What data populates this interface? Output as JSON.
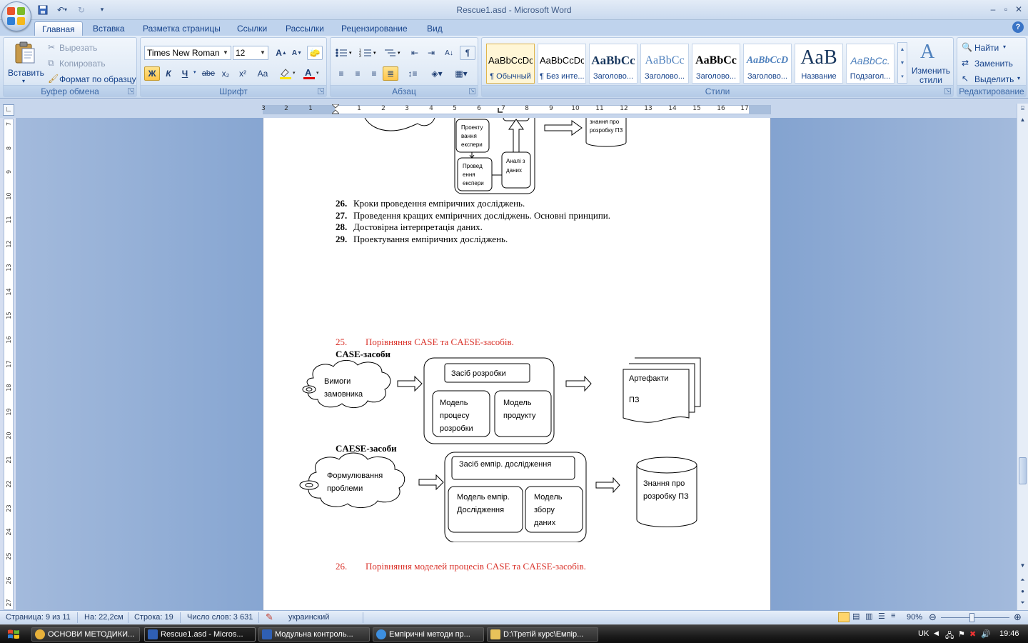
{
  "window": {
    "title": "Rescue1.asd - Microsoft Word",
    "controls": {
      "minimize": "–",
      "maximize": "▫",
      "close": "✕"
    }
  },
  "ribbon_tabs": [
    "Главная",
    "Вставка",
    "Разметка страницы",
    "Ссылки",
    "Рассылки",
    "Рецензирование",
    "Вид"
  ],
  "clipboard": {
    "paste": "Вставить",
    "cut": "Вырезать",
    "copy": "Копировать",
    "format_painter": "Формат по образцу",
    "title": "Буфер обмена"
  },
  "font": {
    "name": "Times New Roman",
    "size": "12",
    "bold": "Ж",
    "italic": "К",
    "underline": "Ч",
    "strike": "abe",
    "subscript": "x₂",
    "superscript": "x²",
    "case": "Aa",
    "title": "Шрифт"
  },
  "paragraph": {
    "title": "Абзац"
  },
  "styles": {
    "title": "Стили",
    "items": [
      {
        "sample": "AaBbCcDc",
        "name": "¶ Обычный"
      },
      {
        "sample": "AaBbCcDc",
        "name": "¶ Без инте..."
      },
      {
        "sample": "AaBbCc",
        "name": "Заголово..."
      },
      {
        "sample": "AaBbCc",
        "name": "Заголово..."
      },
      {
        "sample": "AaBbCc",
        "name": "Заголово..."
      },
      {
        "sample": "AaBbCcD",
        "name": "Заголово..."
      },
      {
        "sample": "AaB",
        "name": "Название"
      },
      {
        "sample": "AaBbCc.",
        "name": "Подзагол..."
      }
    ],
    "change_styles": "Изменить стили"
  },
  "editing": {
    "find": "Найти",
    "replace": "Заменить",
    "select": "Выделить",
    "title": "Редактирование"
  },
  "ruler": {
    "left_nums": [
      "3",
      "2",
      "1"
    ],
    "right_nums": [
      "1",
      "2",
      "3",
      "4",
      "5",
      "6",
      "7",
      "8",
      "9",
      "10",
      "11",
      "12",
      "13",
      "14",
      "15",
      "16",
      "17"
    ],
    "vertical_nums": [
      "7",
      "8",
      "9",
      "10",
      "11",
      "12",
      "13",
      "14",
      "15",
      "16",
      "17",
      "18",
      "19",
      "20",
      "21",
      "22",
      "23",
      "24",
      "25",
      "26",
      "27"
    ]
  },
  "document": {
    "top_diagram": {
      "box_design": "Проекту вання експери",
      "box_conduct": "Провед ення експери",
      "box_analysis": "Аналі з даних",
      "cyl_knowledge": "знання про розробку ПЗ"
    },
    "list_a": [
      {
        "num": "26.",
        "text": "Кроки проведення емпіричних досліджень."
      },
      {
        "num": "27.",
        "text": "Проведення кращих емпіричних досліджень. Основні принципи."
      },
      {
        "num": "28.",
        "text": "Достовірна інтерпретація даних."
      },
      {
        "num": "29.",
        "text": "Проектування емпіричних досліджень."
      }
    ],
    "heading_25": {
      "num": "25.",
      "text": "Порівняння CASE та CAESE-засобів."
    },
    "case_label": "CASE-засоби",
    "case_diagram": {
      "cloud": "Вимоги замовника",
      "tool": "Засіб розробки",
      "process_model": "Модель процесу розробки",
      "product_model": "Модель продукту",
      "artifacts": "Артефакти",
      "artifacts2": "ПЗ"
    },
    "caese_label": "CAESE-засоби",
    "caese_diagram": {
      "cloud": "Формулювання проблеми",
      "tool": "Засіб емпір. дослідження",
      "emp_model": "Модель емпір. Дослідження",
      "collect_model": "Модель збору даних",
      "knowledge": "Знання про розробку ПЗ"
    },
    "heading_26": {
      "num": "26.",
      "text": "Порівняння моделей процесів CASE та CAESE-засобів."
    }
  },
  "status": {
    "page": "Страница: 9 из 11",
    "at": "На: 22,2см",
    "line": "Строка: 19",
    "words": "Число слов: 3 631",
    "language": "украинский",
    "zoom": "90%"
  },
  "taskbar": {
    "items": [
      {
        "label": "ОСНОВИ МЕТОДИКИ...",
        "color": "#e8b13a"
      },
      {
        "label": "Rescue1.asd - Micros...",
        "color": "#2f5fb3"
      },
      {
        "label": "Модульна контроль...",
        "color": "#2f5fb3"
      },
      {
        "label": "Емпіричні методи пр...",
        "color": "#3d8fe0"
      },
      {
        "label": "D:\\Третій курс\\Емпір...",
        "color": "#e8c25a"
      }
    ],
    "lang": "UK",
    "time": "19:46"
  }
}
